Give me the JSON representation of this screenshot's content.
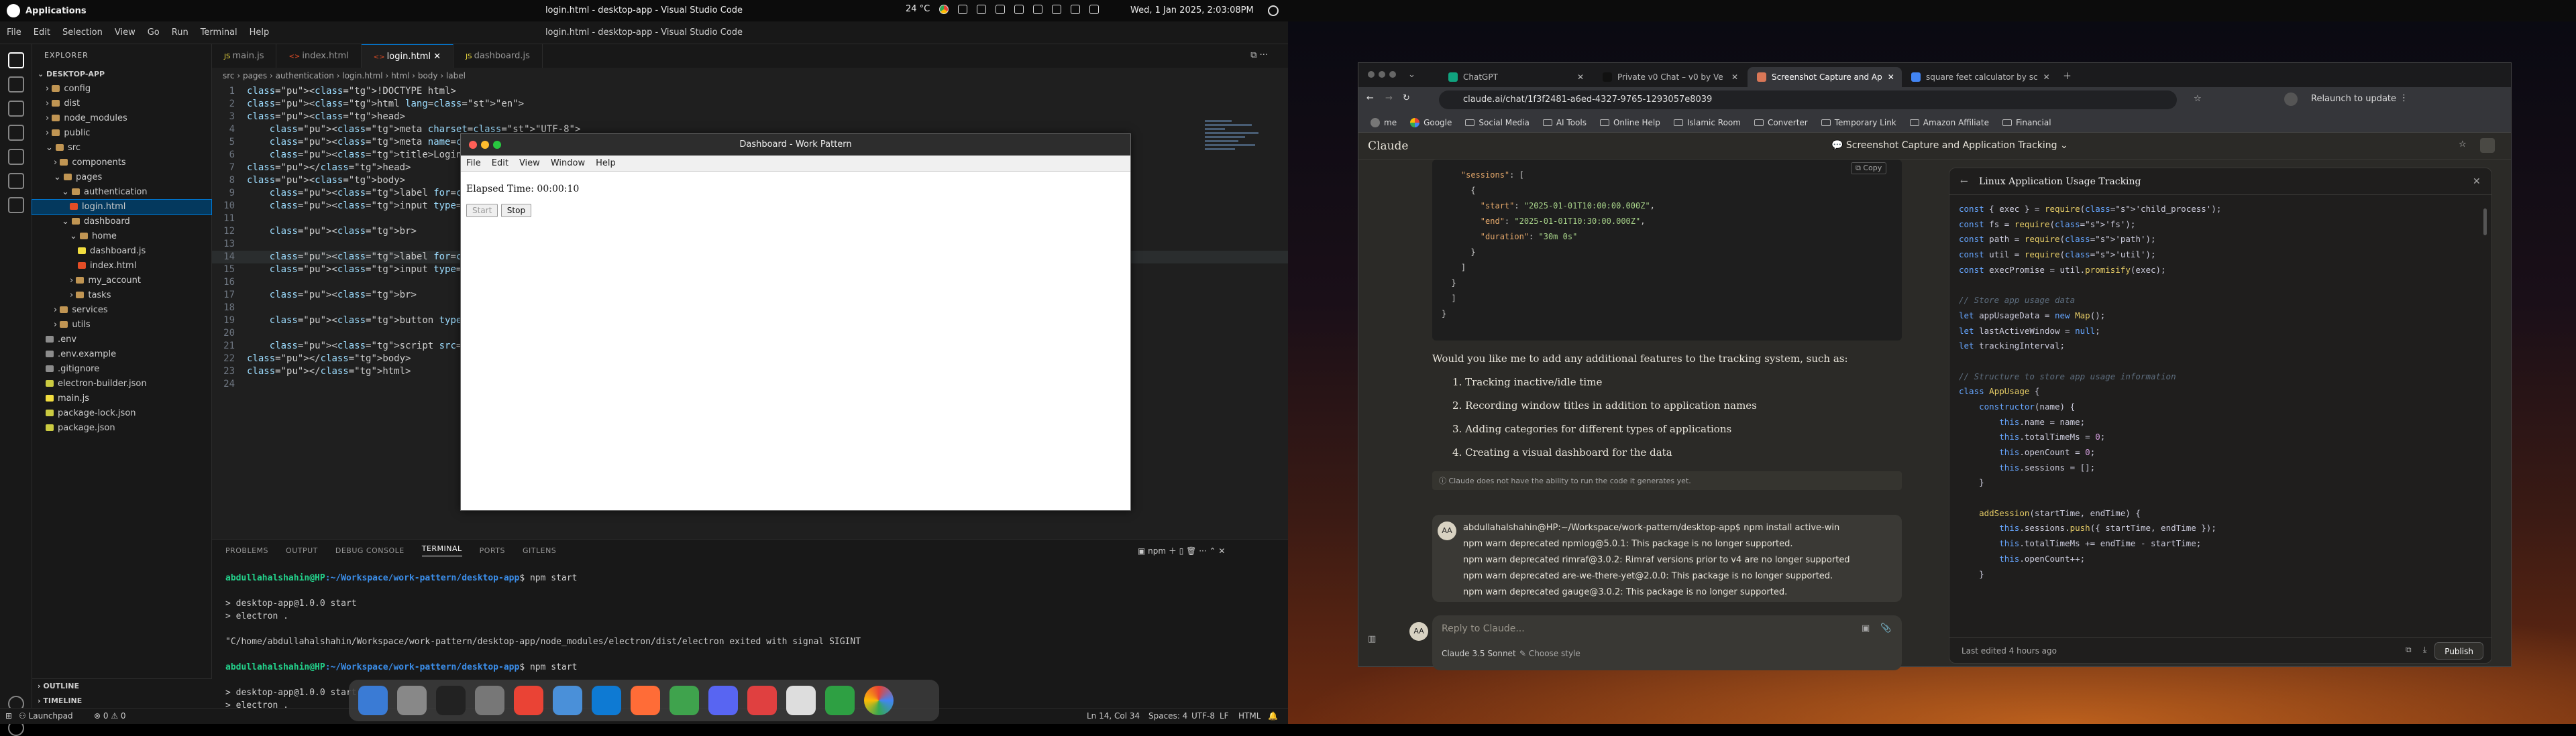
{
  "topbar": {
    "apps_label": "Applications",
    "weather": "24 °C",
    "datetime": "Wed, 1 Jan 2025, 2:03:08PM",
    "window_title": "login.html - desktop-app - Visual Studio Code"
  },
  "vscode": {
    "menu": [
      "File",
      "Edit",
      "Selection",
      "View",
      "Go",
      "Run",
      "Terminal",
      "Help"
    ],
    "explorer_title": "EXPLORER",
    "root_folder": "DESKTOP-APP",
    "tree": [
      {
        "label": "config",
        "depth": 1,
        "kind": "folder"
      },
      {
        "label": "dist",
        "depth": 1,
        "kind": "folder"
      },
      {
        "label": "node_modules",
        "depth": 1,
        "kind": "folder"
      },
      {
        "label": "public",
        "depth": 1,
        "kind": "folder"
      },
      {
        "label": "src",
        "depth": 1,
        "kind": "folder-open"
      },
      {
        "label": "components",
        "depth": 2,
        "kind": "folder"
      },
      {
        "label": "pages",
        "depth": 2,
        "kind": "folder-open"
      },
      {
        "label": "authentication",
        "depth": 3,
        "kind": "folder-open"
      },
      {
        "label": "login.html",
        "depth": 4,
        "kind": "html",
        "selected": true
      },
      {
        "label": "dashboard",
        "depth": 3,
        "kind": "folder-open"
      },
      {
        "label": "home",
        "depth": 4,
        "kind": "folder-open"
      },
      {
        "label": "dashboard.js",
        "depth": 5,
        "kind": "js"
      },
      {
        "label": "index.html",
        "depth": 5,
        "kind": "html"
      },
      {
        "label": "my_account",
        "depth": 4,
        "kind": "folder"
      },
      {
        "label": "tasks",
        "depth": 4,
        "kind": "folder"
      },
      {
        "label": "services",
        "depth": 2,
        "kind": "folder"
      },
      {
        "label": "utils",
        "depth": 2,
        "kind": "folder"
      },
      {
        "label": ".env",
        "depth": 1,
        "kind": "file"
      },
      {
        "label": ".env.example",
        "depth": 1,
        "kind": "file"
      },
      {
        "label": ".gitignore",
        "depth": 1,
        "kind": "file"
      },
      {
        "label": "electron-builder.json",
        "depth": 1,
        "kind": "json"
      },
      {
        "label": "main.js",
        "depth": 1,
        "kind": "js"
      },
      {
        "label": "package-lock.json",
        "depth": 1,
        "kind": "json"
      },
      {
        "label": "package.json",
        "depth": 1,
        "kind": "json"
      }
    ],
    "outline_label": "OUTLINE",
    "timeline_label": "TIMELINE",
    "tabs": [
      {
        "label": "main.js",
        "active": false
      },
      {
        "label": "index.html",
        "active": false
      },
      {
        "label": "login.html",
        "active": true
      },
      {
        "label": "dashboard.js",
        "active": false
      }
    ],
    "breadcrumb": "src › pages › authentication › login.html › html › body › label",
    "code_lines": [
      {
        "n": "1",
        "t": "<!DOCTYPE html>"
      },
      {
        "n": "2",
        "t": "<html lang=\"en\">"
      },
      {
        "n": "3",
        "t": "<head>"
      },
      {
        "n": "4",
        "t": "    <meta charset=\"UTF-8\">"
      },
      {
        "n": "5",
        "t": "    <meta name=\"viewport\" content"
      },
      {
        "n": "6",
        "t": "    <title>Login - Work Pattern<"
      },
      {
        "n": "7",
        "t": "</head>"
      },
      {
        "n": "8",
        "t": "<body>"
      },
      {
        "n": "9",
        "t": "    <label for=\"email_or_mobile_"
      },
      {
        "n": "10",
        "t": "    <input type=\"text\" id=\"email"
      },
      {
        "n": "11",
        "t": ""
      },
      {
        "n": "12",
        "t": "    <br>"
      },
      {
        "n": "13",
        "t": ""
      },
      {
        "n": "14",
        "t": "    <label for=\"password\">Passwo"
      },
      {
        "n": "15",
        "t": "    <input type=\"text\" id=\"passw"
      },
      {
        "n": "16",
        "t": ""
      },
      {
        "n": "17",
        "t": "    <br>"
      },
      {
        "n": "18",
        "t": ""
      },
      {
        "n": "19",
        "t": "    <button type=\"submit\" id=\"su"
      },
      {
        "n": "20",
        "t": ""
      },
      {
        "n": "21",
        "t": "    <script src=\"../../services"
      },
      {
        "n": "22",
        "t": "</body>"
      },
      {
        "n": "23",
        "t": "</html>"
      },
      {
        "n": "24",
        "t": ""
      }
    ],
    "panel_tabs": [
      "PROBLEMS",
      "OUTPUT",
      "DEBUG CONSOLE",
      "TERMINAL",
      "PORTS",
      "GITLENS"
    ],
    "terminal_shell": "npm",
    "terminal_lines": [
      {
        "user": "abdullahalshahin@HP",
        "path": ":~/Workspace/work-pattern/desktop-app",
        "cmd": "$ npm start"
      },
      {
        "text": ""
      },
      {
        "text": "> desktop-app@1.0.0 start"
      },
      {
        "text": "> electron ."
      },
      {
        "text": ""
      },
      {
        "text": "\"C/home/abdullahalshahin/Workspace/work-pattern/desktop-app/node_modules/electron/dist/electron exited with signal SIGINT"
      },
      {
        "text": ""
      },
      {
        "user": "abdullahalshahin@HP",
        "path": ":~/Workspace/work-pattern/desktop-app",
        "cmd": "$ npm start"
      },
      {
        "text": ""
      },
      {
        "text": "> desktop-app@1.0.0 start"
      },
      {
        "text": "> electron ."
      }
    ],
    "status": {
      "launchpad": "Launchpad",
      "problems": "⊗ 0 ⚠ 0",
      "cursor": "Ln 14, Col 34",
      "spaces": "Spaces: 4",
      "encoding": "UTF-8",
      "eol": "LF",
      "language": "HTML"
    }
  },
  "electron": {
    "title": "Dashboard - Work Pattern",
    "menu": [
      "File",
      "Edit",
      "View",
      "Window",
      "Help"
    ],
    "elapsed": "Elapsed Time: 00:00:10",
    "start_label": "Start",
    "stop_label": "Stop"
  },
  "dock": {
    "apps": [
      "finder-icon",
      "trash-icon",
      "terminal-icon",
      "settings-icon",
      "chrome-icon",
      "files-icon",
      "vscode-icon",
      "postman-icon",
      "mongodb-icon",
      "discord-icon",
      "tasks-icon",
      "notes-icon",
      "monitor-icon",
      "apps-grid-icon"
    ]
  },
  "browser": {
    "tabs": [
      {
        "label": "ChatGPT",
        "active": false
      },
      {
        "label": "Private v0 Chat – v0 by Ve",
        "active": false
      },
      {
        "label": "Screenshot Capture and Ap",
        "active": true
      },
      {
        "label": "square feet calculator by sc",
        "active": false
      }
    ],
    "url": "claude.ai/chat/1f3f2481-a6ed-4327-9765-1293057e8039",
    "relaunch": "Relaunch to update",
    "bookmarks": [
      "me",
      "Google",
      "Social Media",
      "AI Tools",
      "Online Help",
      "Islamic Room",
      "Converter",
      "Temporary Link",
      "Amazon Affiliate",
      "Financial"
    ]
  },
  "claude": {
    "brand": "Claude",
    "conversation_title": "Screenshot Capture and Application Tracking",
    "copy_label": "Copy",
    "json_lines": [
      "    \"sessions\": [",
      "      {",
      "        \"start\": \"2025-01-01T10:00:00.000Z\",",
      "        \"end\": \"2025-01-01T10:30:00.000Z\",",
      "        \"duration\": \"30m 0s\"",
      "      }",
      "    ]",
      "  }",
      "  ]",
      "}"
    ],
    "question": "Would you like me to add any additional features to the tracking system, such as:",
    "options": [
      "1. Tracking inactive/idle time",
      "2. Recording window titles in addition to application names",
      "3. Adding categories for different types of applications",
      "4. Creating a visual dashboard for the data"
    ],
    "disclaimer": "Claude does not have the ability to run the code it generates yet.",
    "user_initials": "AA",
    "user_message_lines": [
      "abdullahalshahin@HP:~/Workspace/work-pattern/desktop-app$ npm install active-win",
      "npm warn deprecated npmlog@5.0.1: This package is no longer supported.",
      "npm warn deprecated rimraf@3.0.2: Rimraf versions prior to v4 are no longer supported",
      "npm warn deprecated are-we-there-yet@2.0.0: This package is no longer supported.",
      "npm warn deprecated gauge@3.0.2: This package is no longer supported."
    ],
    "reply_placeholder": "Reply to Claude...",
    "model": "Claude 3.5 Sonnet",
    "style": "Choose style",
    "artifact": {
      "title": "Linux Application Usage Tracking",
      "code_lines": [
        "const { exec } = require('child_process');",
        "const fs = require('fs');",
        "const path = require('path');",
        "const util = require('util');",
        "const execPromise = util.promisify(exec);",
        "",
        "// Store app usage data",
        "let appUsageData = new Map();",
        "let lastActiveWindow = null;",
        "let trackingInterval;",
        "",
        "// Structure to store app usage information",
        "class AppUsage {",
        "    constructor(name) {",
        "        this.name = name;",
        "        this.totalTimeMs = 0;",
        "        this.openCount = 0;",
        "        this.sessions = [];",
        "    }",
        "",
        "    addSession(startTime, endTime) {",
        "        this.sessions.push({ startTime, endTime });",
        "        this.totalTimeMs += endTime - startTime;",
        "        this.openCount++;",
        "    }"
      ],
      "last_edited": "Last edited 4 hours ago",
      "publish": "Publish"
    }
  },
  "colors": {
    "accent": "#0078d4",
    "terminal_user": "#23d18b",
    "terminal_path": "#3b8eea"
  }
}
